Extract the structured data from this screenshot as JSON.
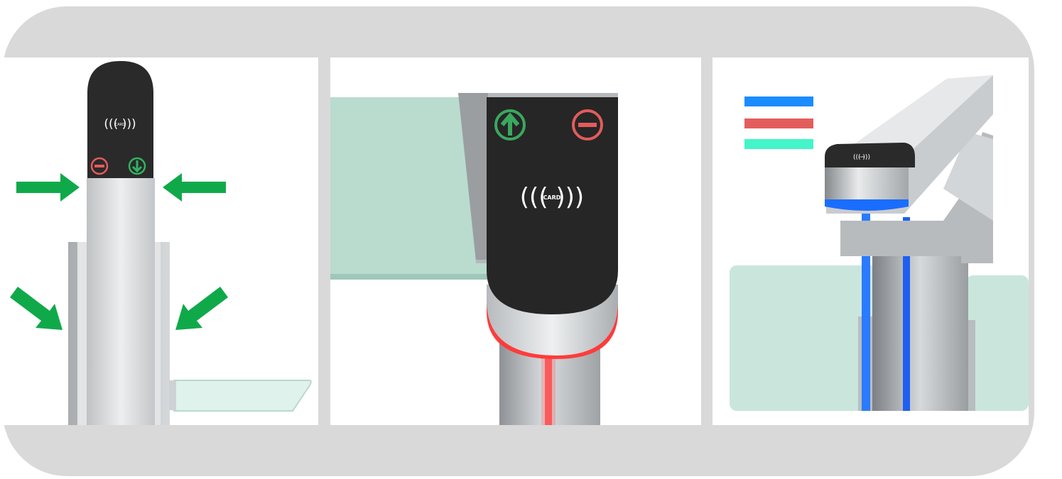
{
  "colors": {
    "frame": "#d9d9d9",
    "arrow_green": "#10a94a",
    "glass": "#b8ddd0",
    "stainless": "#c7cacc",
    "panel_dark": "#2b2b2b",
    "light_red": "#ff3b3b",
    "light_blue": "#1e6fff",
    "legend_blue": "#1a8cff",
    "legend_red": "#e35d5d",
    "legend_aqua": "#43f5c9"
  },
  "panels": {
    "left": {
      "card_label": "CARD"
    },
    "center": {
      "card_label": "CARD"
    },
    "right": {
      "card_label": "CARD"
    }
  },
  "legend": [
    {
      "color": "#1a8cff",
      "icon": "blue-light-swatch"
    },
    {
      "color": "#e35d5d",
      "icon": "red-light-swatch"
    },
    {
      "color": "#43f5c9",
      "icon": "aqua-light-swatch"
    }
  ],
  "icons": [
    "rfid-card-icon",
    "stop-icon",
    "arrow-down-icon",
    "arrow-up-icon",
    "pointer-arrow-icon"
  ]
}
